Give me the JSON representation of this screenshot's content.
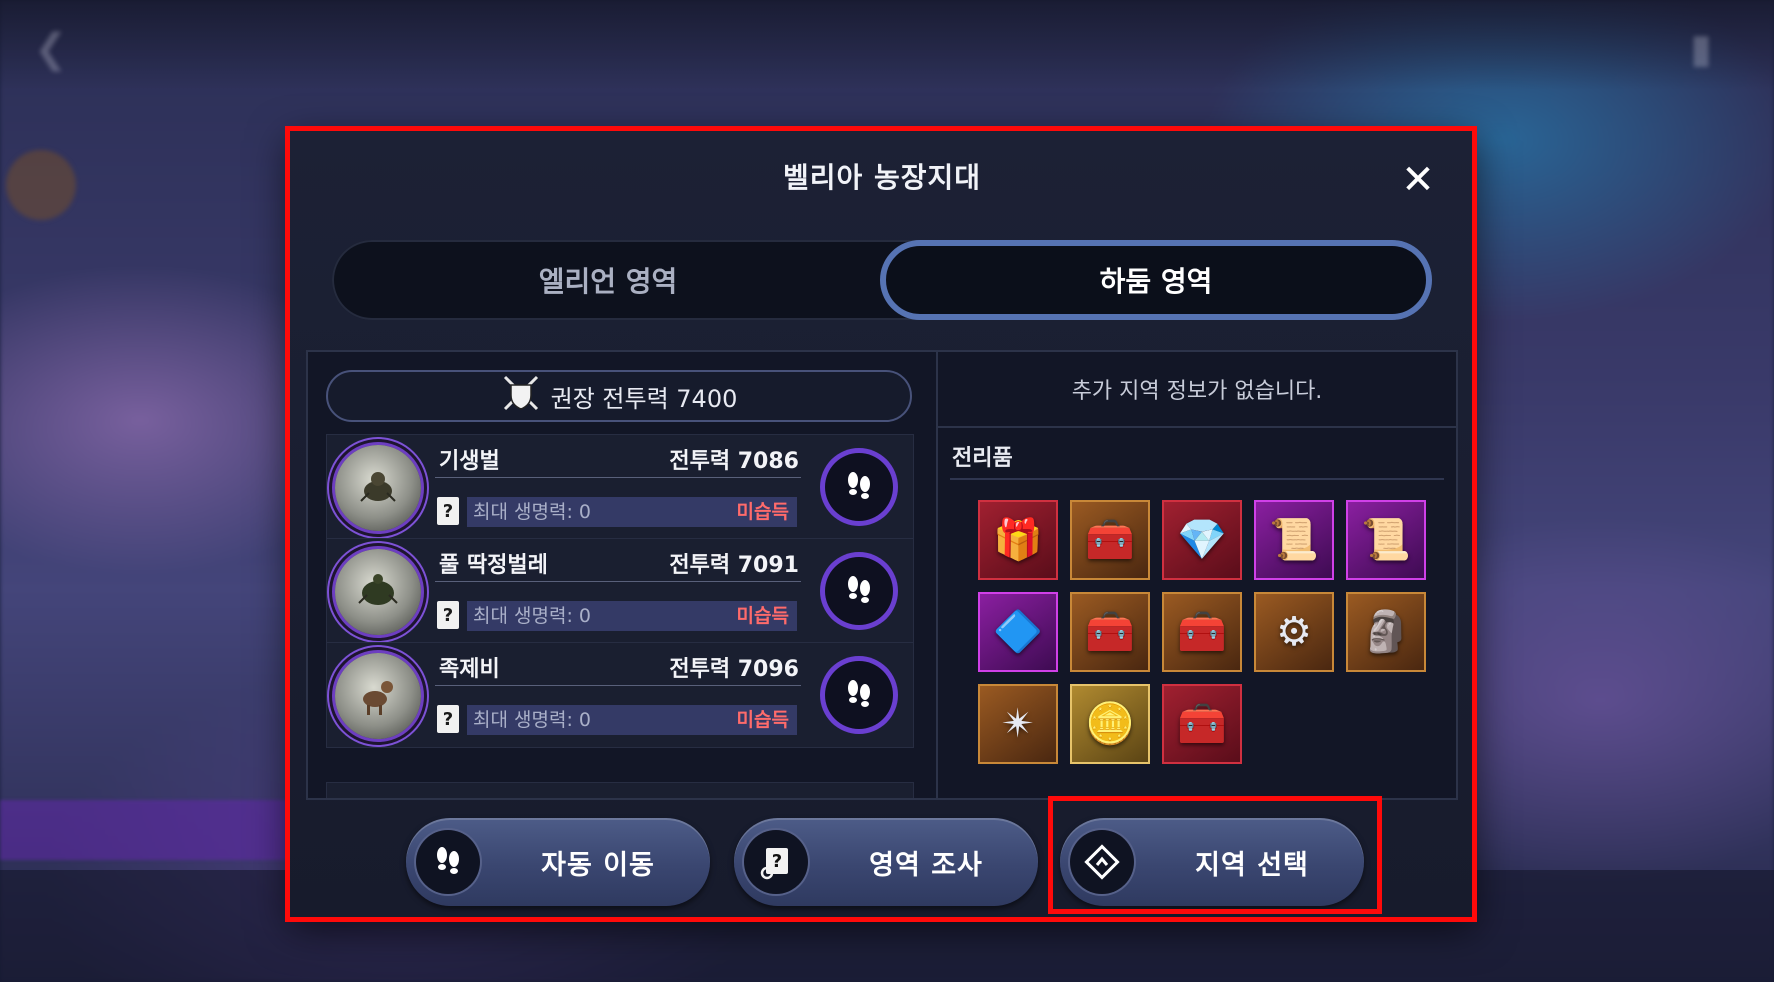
{
  "modal": {
    "title": "벨리아 농장지대",
    "close_label": "✕"
  },
  "tabs": [
    {
      "label": "엘리언 영역",
      "active": false
    },
    {
      "label": "하둠 영역",
      "active": true
    }
  ],
  "recommended": {
    "label": "권장 전투력 7400"
  },
  "monsters": [
    {
      "name": "기생벌",
      "power": "전투력 7086",
      "stat": "최대 생명력: 0",
      "status": "미습득"
    },
    {
      "name": "풀 딱정벌레",
      "power": "전투력 7091",
      "stat": "최대 생명력: 0",
      "status": "미습득"
    },
    {
      "name": "족제비",
      "power": "전투력 7096",
      "stat": "최대 생명력: 0",
      "status": "미습득"
    }
  ],
  "region_info": "추가 지역 정보가 없습니다.",
  "loot": {
    "title": "전리품",
    "items": [
      {
        "icon": "red-jewel-box",
        "glyph": "🎁",
        "grade": "red"
      },
      {
        "icon": "gem-chest",
        "glyph": "🧰",
        "grade": "orange"
      },
      {
        "icon": "purple-crystal",
        "glyph": "💎",
        "grade": "red"
      },
      {
        "icon": "scroll",
        "glyph": "📜",
        "grade": "purple"
      },
      {
        "icon": "rune-scroll",
        "glyph": "📜",
        "grade": "purple"
      },
      {
        "icon": "blue-crystal",
        "glyph": "🔷",
        "grade": "purple"
      },
      {
        "icon": "red-chest",
        "glyph": "🧰",
        "grade": "orange"
      },
      {
        "icon": "treasure-chest",
        "glyph": "🧰",
        "grade": "orange"
      },
      {
        "icon": "disc-token",
        "glyph": "⚙",
        "grade": "orange"
      },
      {
        "icon": "crystal-statue",
        "glyph": "🗿",
        "grade": "orange"
      },
      {
        "icon": "emblem-crest",
        "glyph": "✴",
        "grade": "orange"
      },
      {
        "icon": "gold-coin",
        "glyph": "🪙",
        "grade": "gold"
      },
      {
        "icon": "dark-chest",
        "glyph": "🧰",
        "grade": "red"
      }
    ]
  },
  "buttons": {
    "auto_move": "자동 이동",
    "survey": "영역 조사",
    "region_select": "지역 선택"
  },
  "colors": {
    "highlight": "#ff0a0a",
    "active_tab_border": "#5673b3",
    "not_acquired": "#ff6b6b",
    "move_ring": "#6a3fd0"
  }
}
